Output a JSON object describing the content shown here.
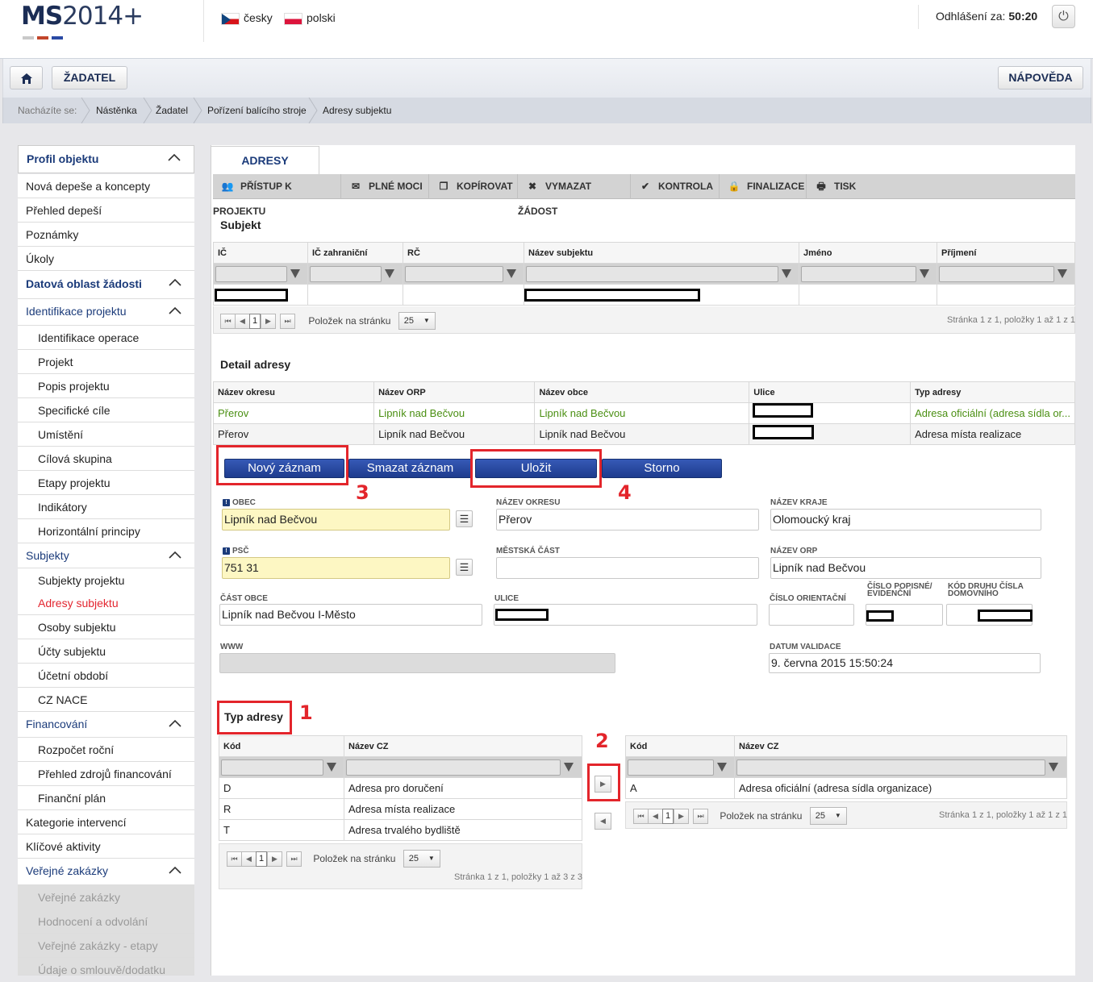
{
  "header": {
    "logo_ms": "MS",
    "logo_year": "2014+",
    "lang_cz": "česky",
    "lang_pl": "polski",
    "logout_label": "Odhlášení za:",
    "logout_time": "50:20"
  },
  "nav": {
    "zadatel": "ŽADATEL",
    "napoveda": "NÁPOVĚDA"
  },
  "breadcrumb": {
    "label": "Nacházíte se:",
    "items": [
      "Nástěnka",
      "Žadatel",
      "Pořízení balícího stroje",
      "Adresy subjektu"
    ]
  },
  "sidebar": {
    "items": [
      {
        "label": "Profil objektu"
      },
      {
        "label": "Nová depeše a koncepty"
      },
      {
        "label": "Přehled depeší"
      },
      {
        "label": "Poznámky"
      },
      {
        "label": "Úkoly"
      },
      {
        "label": "Datová oblast žádosti"
      },
      {
        "label": "Identifikace projektu"
      },
      {
        "label": "Identifikace operace"
      },
      {
        "label": "Projekt"
      },
      {
        "label": "Popis projektu"
      },
      {
        "label": "Specifické cíle"
      },
      {
        "label": "Umístění"
      },
      {
        "label": "Cílová skupina"
      },
      {
        "label": "Etapy projektu"
      },
      {
        "label": "Indikátory"
      },
      {
        "label": "Horizontální principy"
      },
      {
        "label": "Subjekty"
      },
      {
        "label": "Subjekty projektu"
      },
      {
        "label": "Adresy subjektu"
      },
      {
        "label": "Osoby subjektu"
      },
      {
        "label": "Účty subjektu"
      },
      {
        "label": "Účetní období"
      },
      {
        "label": "CZ NACE"
      },
      {
        "label": "Financování"
      },
      {
        "label": "Rozpočet roční"
      },
      {
        "label": "Přehled zdrojů financování"
      },
      {
        "label": "Finanční plán"
      },
      {
        "label": "Kategorie intervencí"
      },
      {
        "label": "Klíčové aktivity"
      },
      {
        "label": "Veřejné zakázky"
      },
      {
        "label": "Veřejné zakázky"
      },
      {
        "label": "Hodnocení a odvolání"
      },
      {
        "label": "Veřejné zakázky - etapy"
      },
      {
        "label": "Údaje o smlouvě/dodatku"
      }
    ]
  },
  "tab": {
    "title": "ADRESY SUBJEKTU"
  },
  "toolbar": {
    "items": [
      "PŘÍSTUP K PROJEKTU",
      "PLNÉ MOCI",
      "KOPÍROVAT",
      "VYMAZAT ŽÁDOST",
      "KONTROLA",
      "FINALIZACE",
      "TISK"
    ]
  },
  "subjekt": {
    "title": "Subjekt",
    "columns": [
      "IČ",
      "IČ zahraniční",
      "RČ",
      "Název subjektu",
      "Jméno",
      "Příjmení"
    ],
    "pager": {
      "page": "1",
      "per_page_label": "Položek na stránku",
      "per_page": "25",
      "info_prefix": "Stránka",
      "info": "1 z 1, položky 1 až 1 z 1"
    }
  },
  "detail": {
    "title": "Detail adresy",
    "columns": [
      "Název okresu",
      "Název ORP",
      "Název obce",
      "Ulice",
      "Typ adresy"
    ],
    "rows": [
      [
        "Přerov",
        "Lipník nad Bečvou",
        "Lipník nad Bečvou",
        "",
        "Adresa oficiální (adresa sídla or..."
      ],
      [
        "Přerov",
        "Lipník nad Bečvou",
        "Lipník nad Bečvou",
        "",
        "Adresa místa realizace"
      ]
    ]
  },
  "actions": {
    "novy": "Nový záznam",
    "smazat": "Smazat záznam",
    "ulozit": "Uložit",
    "storno": "Storno"
  },
  "form": {
    "obec_label": "OBEC",
    "obec": "Lipník nad Bečvou",
    "okres_label": "NÁZEV OKRESU",
    "okres": "Přerov",
    "kraj_label": "NÁZEV KRAJE",
    "kraj": "Olomoucký kraj",
    "psc_label": "PSČ",
    "psc": "751 31",
    "mestska_label": "MĚSTSKÁ ČÁST",
    "mestska": "",
    "orp_label": "NÁZEV ORP",
    "orp": "Lipník nad Bečvou",
    "cast_label": "ČÁST OBCE",
    "cast": "Lipník nad Bečvou I-Město",
    "ulice_label": "ULICE",
    "orient_label": "ČÍSLO ORIENTAČNÍ",
    "popisne_label": "ČÍSLO POPISNÉ/ EVIDENČNÍ",
    "druh_label": "KÓD DRUHU ČÍSLA DOMOVNÍHO",
    "www_label": "WWW",
    "validace_label": "DATUM VALIDACE",
    "validace": "9. června 2015 15:50:24"
  },
  "typ": {
    "title": "Typ adresy",
    "col_kod": "Kód",
    "col_nazev": "Název CZ",
    "left_rows": [
      [
        "D",
        "Adresa pro doručení"
      ],
      [
        "R",
        "Adresa místa realizace"
      ],
      [
        "T",
        "Adresa trvalého bydliště"
      ]
    ],
    "left_info": "1 z 1, položky 1 až 3 z 3",
    "right_rows": [
      [
        "A",
        "Adresa oficiální (adresa sídla organizace)"
      ]
    ],
    "right_info": "1 z 1, položky 1 až 1 z 1"
  },
  "annotations": {
    "n1": "1",
    "n2": "2",
    "n3": "3",
    "n4": "4"
  },
  "colors": {
    "brand": "#1b3b7a",
    "accent_red": "#e3252b",
    "button_blue": "#2a4aa4",
    "required_bg": "#fdf7c3"
  }
}
